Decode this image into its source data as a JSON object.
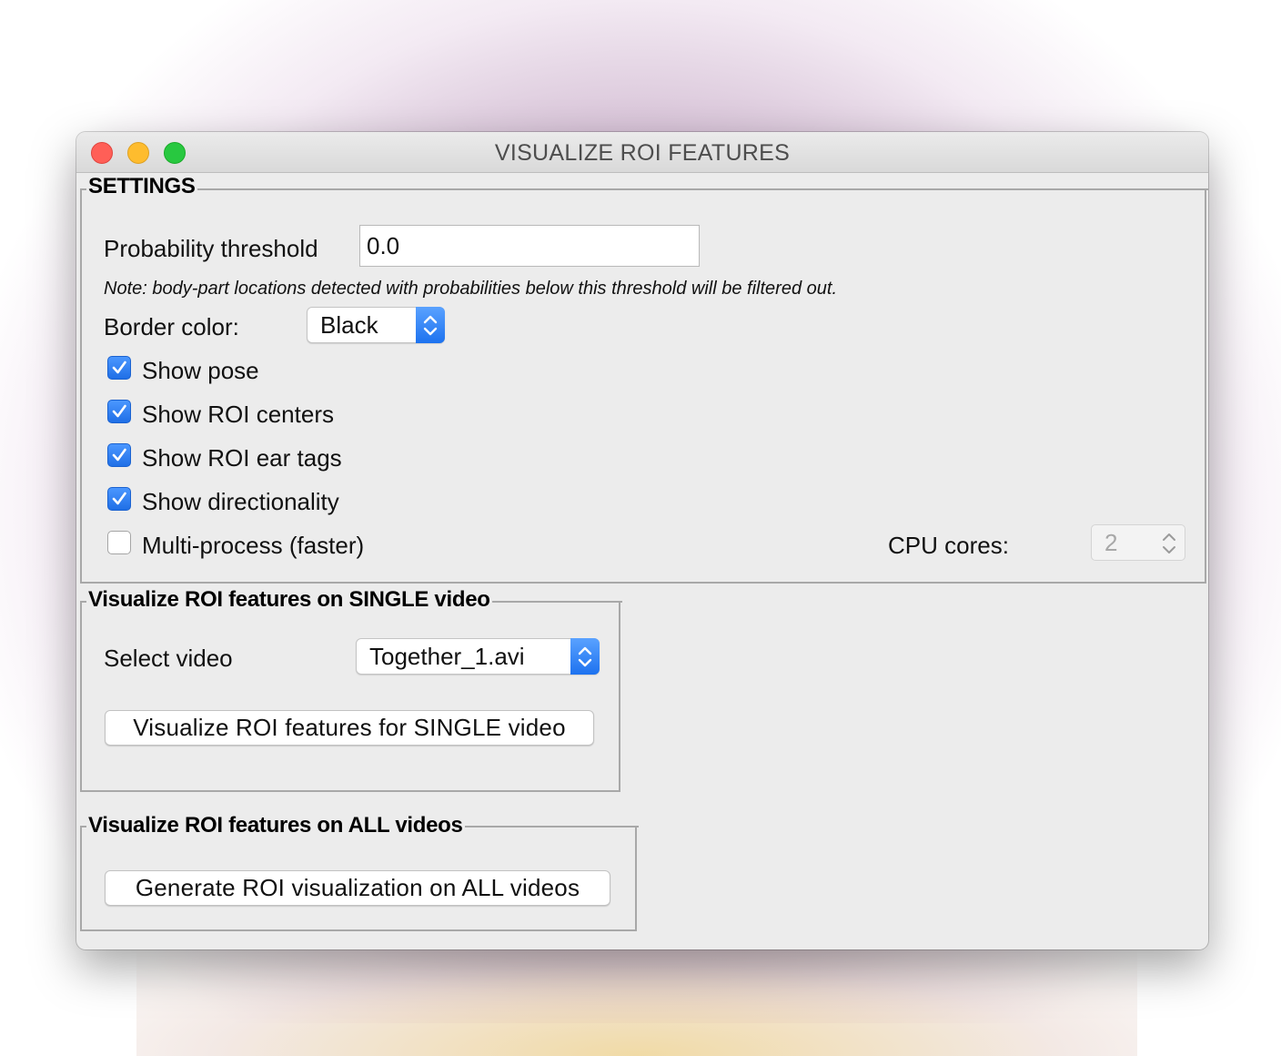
{
  "window": {
    "title": "VISUALIZE ROI FEATURES"
  },
  "settings": {
    "title": "SETTINGS",
    "probability_threshold": {
      "label": "Probability threshold",
      "value": "0.0"
    },
    "note": "Note: body-part locations detected with probabilities below this threshold will be filtered out.",
    "border_color": {
      "label": "Border color:",
      "selected": "Black"
    },
    "checkboxes": [
      {
        "label": "Show pose",
        "checked": true
      },
      {
        "label": "Show ROI centers",
        "checked": true
      },
      {
        "label": "Show ROI ear tags",
        "checked": true
      },
      {
        "label": "Show directionality",
        "checked": true
      },
      {
        "label": "Multi-process (faster)",
        "checked": false
      }
    ],
    "cpu_cores": {
      "label": "CPU cores:",
      "value": "2",
      "enabled": false
    }
  },
  "single_video": {
    "title": "Visualize ROI features on SINGLE video",
    "select_label": "Select video",
    "selected_video": "Together_1.avi",
    "button_label": "Visualize ROI features for SINGLE video"
  },
  "all_videos": {
    "title": "Visualize ROI features on ALL videos",
    "button_label": "Generate ROI visualization on ALL videos"
  },
  "colors": {
    "accent": "#2a7af5",
    "close": "#ff5f57",
    "minimize": "#febc2e",
    "zoom": "#28c840"
  }
}
